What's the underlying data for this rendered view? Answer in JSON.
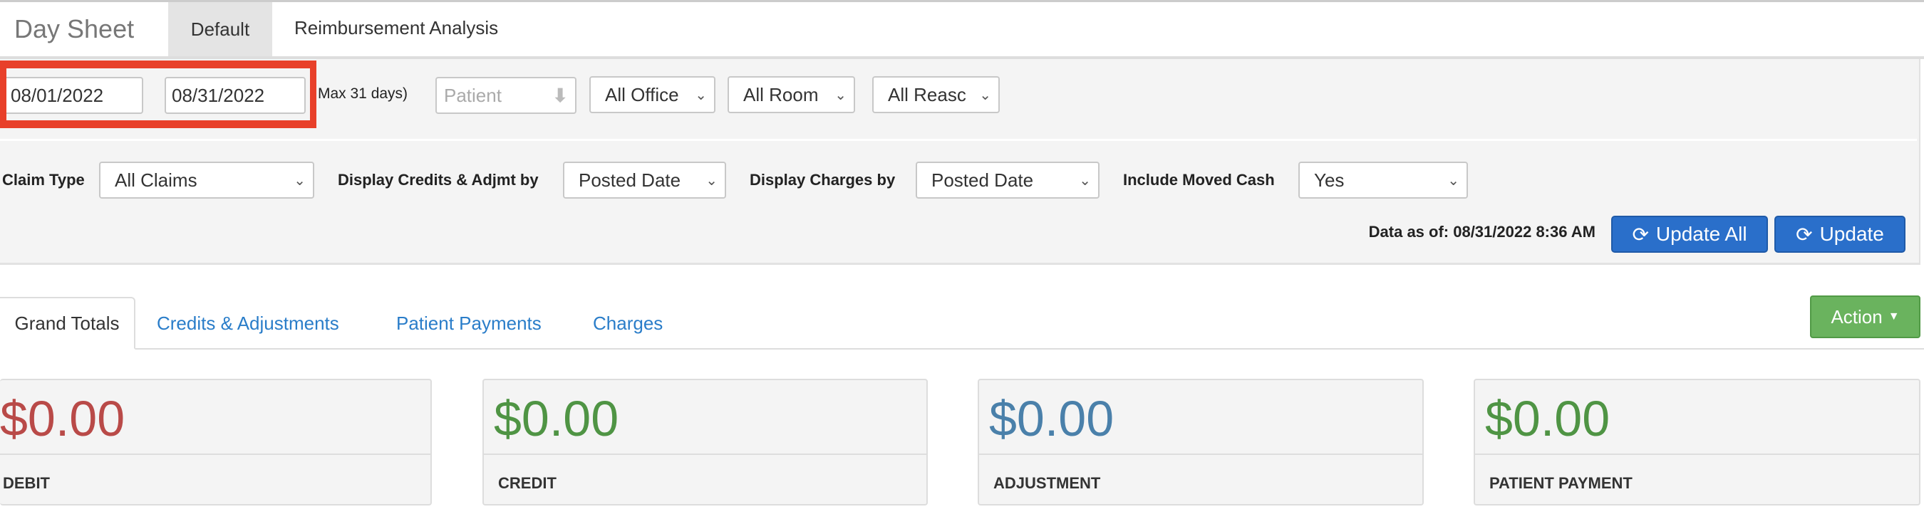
{
  "header": {
    "title": "Day Sheet",
    "tabs": [
      {
        "label": "Default",
        "active": true
      },
      {
        "label": "Reimbursement Analysis",
        "active": false
      }
    ]
  },
  "filters": {
    "start_date": "08/01/2022",
    "end_date": "08/31/2022",
    "max_note": "Max 31 days)",
    "patient_placeholder": "Patient",
    "office": "All Office",
    "room": "All Room",
    "reason": "All Reasc",
    "claim_type_label": "Claim Type",
    "claim_type": "All Claims",
    "credits_label": "Display Credits & Adjmt by",
    "credits_value": "Posted Date",
    "charges_label": "Display Charges by",
    "charges_value": "Posted Date",
    "moved_cash_label": "Include Moved Cash",
    "moved_cash_value": "Yes",
    "data_as_of": "Data as of: 08/31/2022 8:36 AM",
    "update_all": "Update All",
    "update": "Update"
  },
  "main_tabs": [
    {
      "label": "Grand Totals",
      "active": true
    },
    {
      "label": "Credits & Adjustments"
    },
    {
      "label": "Patient Payments"
    },
    {
      "label": "Charges"
    }
  ],
  "action_label": "Action",
  "cards": [
    {
      "amount": "$0.00",
      "label": "DEBIT",
      "color": "#b94a48"
    },
    {
      "amount": "$0.00",
      "label": "CREDIT",
      "color": "#4f9444"
    },
    {
      "amount": "$0.00",
      "label": "ADJUSTMENT",
      "color": "#4a80aa"
    },
    {
      "amount": "$0.00",
      "label": "PATIENT PAYMENT",
      "color": "#4f9444"
    }
  ],
  "colors": {
    "highlight": "#e8402a",
    "primary": "#2a6fca",
    "success": "#6ab35e",
    "link": "#2a7dc9"
  }
}
